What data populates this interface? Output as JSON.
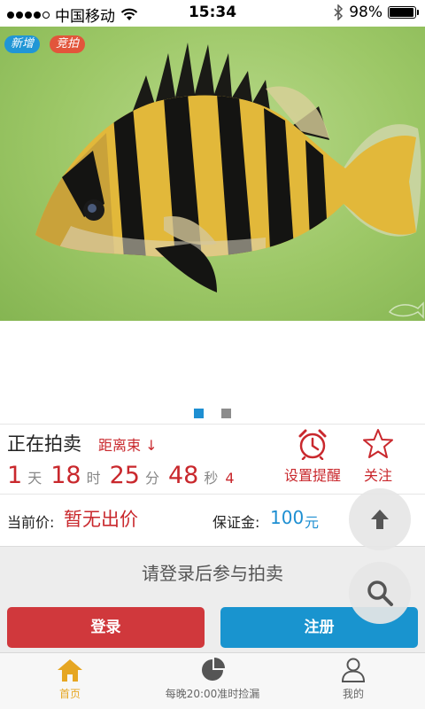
{
  "status_bar": {
    "carrier": "中国移动",
    "time": "15:34",
    "battery": "98%",
    "battery_level": 0.98
  },
  "banner": {
    "tags": [
      "新增",
      "竞拍"
    ],
    "carousel_total": 2,
    "carousel_active": 1
  },
  "auction": {
    "title": "正在拍卖",
    "countdown_label": "距离束 ↓",
    "days": "1",
    "days_unit": "天",
    "hours": "18",
    "hours_unit": "时",
    "minutes": "25",
    "minutes_unit": "分",
    "seconds": "48",
    "seconds_unit": "秒",
    "tenths": "4",
    "remind_label": "设置提醒",
    "follow_label": "关注"
  },
  "price": {
    "current_label": "当前价:",
    "current_value": "暂无出价",
    "deposit_label": "保证金:",
    "deposit_value": "100",
    "deposit_unit": "元"
  },
  "login": {
    "prompt": "请登录后参与拍卖",
    "login_label": "登录",
    "register_label": "注册"
  },
  "tabs": [
    {
      "label": "首页",
      "icon": "home-icon",
      "active": true
    },
    {
      "label": "每晚20:00准时捡漏",
      "icon": "pie-chart-icon",
      "active": false
    },
    {
      "label": "我的",
      "icon": "user-icon",
      "active": false
    }
  ],
  "colors": {
    "accent_red": "#c9282d",
    "accent_blue": "#1e8fd2",
    "active_tab": "#e6a622"
  }
}
